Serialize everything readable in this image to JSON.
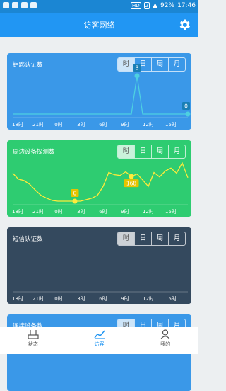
{
  "status_bar": {
    "battery": "92%",
    "time": "17:46",
    "hd": "HD",
    "sim": "2"
  },
  "header": {
    "title": "访客网络"
  },
  "colors": {
    "primary": "#2196f3",
    "card1": "#3a98e8",
    "card2": "#2ecc71",
    "card3": "#34495e",
    "card4": "#3a98e8"
  },
  "segment_labels": [
    "时",
    "日",
    "周",
    "月"
  ],
  "cards": [
    {
      "title": "钥匙认证数"
    },
    {
      "title": "周边设备探测数"
    },
    {
      "title": "短信认证数"
    },
    {
      "title": "连接设备数"
    }
  ],
  "x_ticks": [
    "18时",
    "21时",
    "0时",
    "3时",
    "6时",
    "9时",
    "12时",
    "15时"
  ],
  "chart_data": [
    {
      "type": "line",
      "title": "钥匙认证数",
      "categories": [
        "18时",
        "21时",
        "0时",
        "3时",
        "6时",
        "9时",
        "12时",
        "15时"
      ],
      "series": [
        {
          "values": [
            0,
            0,
            0,
            0,
            0,
            0,
            0,
            0,
            0,
            0,
            0,
            0,
            0,
            0,
            0,
            0,
            0,
            0,
            0,
            0,
            0,
            0,
            3,
            0,
            0,
            0,
            0,
            0,
            0,
            0,
            0,
            0
          ]
        }
      ],
      "annotations": [
        {
          "label": "3",
          "index": 22
        },
        {
          "label": "0",
          "index": 31
        }
      ]
    },
    {
      "type": "line",
      "title": "周边设备探测数",
      "categories": [
        "18时",
        "21时",
        "0时",
        "3时",
        "6时",
        "9时",
        "12时",
        "15时"
      ],
      "series": [
        {
          "values": [
            190,
            150,
            140,
            115,
            75,
            40,
            20,
            5,
            0,
            0,
            0,
            0,
            0,
            10,
            20,
            40,
            100,
            195,
            180,
            175,
            200,
            168,
            185,
            145,
            100,
            195,
            165,
            205,
            225,
            190,
            260,
            160
          ]
        }
      ],
      "annotations": [
        {
          "label": "0",
          "index": 11
        },
        {
          "label": "168",
          "index": 21
        }
      ]
    },
    {
      "type": "line",
      "title": "短信认证数",
      "categories": [
        "18时",
        "21时",
        "0时",
        "3时",
        "6时",
        "9时",
        "12时",
        "15时"
      ],
      "series": [
        {
          "values": []
        }
      ]
    }
  ],
  "tabs": [
    {
      "label": "状态"
    },
    {
      "label": "访客"
    },
    {
      "label": "我的"
    }
  ]
}
